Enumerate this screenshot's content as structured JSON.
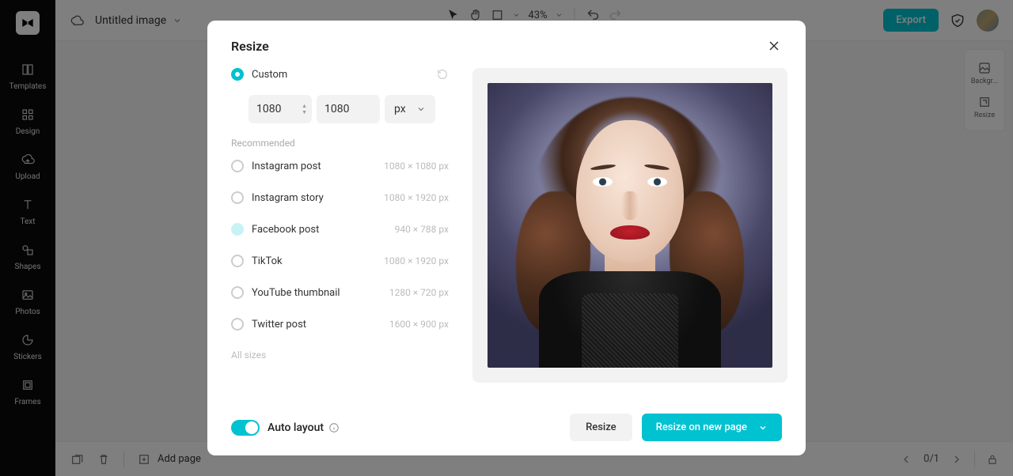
{
  "header": {
    "title": "Untitled image",
    "zoom": "43%",
    "export_label": "Export"
  },
  "sidebar": {
    "items": [
      {
        "label": "Templates"
      },
      {
        "label": "Design"
      },
      {
        "label": "Upload"
      },
      {
        "label": "Text"
      },
      {
        "label": "Shapes"
      },
      {
        "label": "Photos"
      },
      {
        "label": "Stickers"
      },
      {
        "label": "Frames"
      }
    ]
  },
  "right_rail": {
    "items": [
      {
        "label": "Backgr..."
      },
      {
        "label": "Resize"
      }
    ]
  },
  "bottombar": {
    "add_page": "Add page",
    "page_count": "0/1"
  },
  "modal": {
    "title": "Resize",
    "custom_label": "Custom",
    "width": "1080",
    "height": "1080",
    "unit": "px",
    "recommended_label": "Recommended",
    "presets": [
      {
        "name": "Instagram post",
        "dims": "1080 × 1080 px"
      },
      {
        "name": "Instagram story",
        "dims": "1080 × 1920 px"
      },
      {
        "name": "Facebook post",
        "dims": "940 × 788 px"
      },
      {
        "name": "TikTok",
        "dims": "1080 × 1920 px"
      },
      {
        "name": "YouTube thumbnail",
        "dims": "1280 × 720 px"
      },
      {
        "name": "Twitter post",
        "dims": "1600 × 900 px"
      }
    ],
    "all_sizes_label": "All sizes",
    "auto_layout_label": "Auto layout",
    "resize_btn": "Resize",
    "resize_new_btn": "Resize on new page"
  }
}
